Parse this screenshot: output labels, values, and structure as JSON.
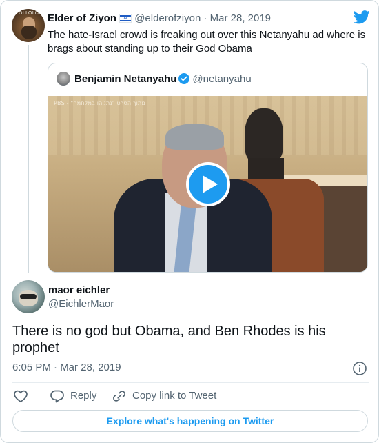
{
  "parent": {
    "avatar_caption": "LOLLOLOL",
    "name": "Elder of Ziyon",
    "handle": "@elderofziyon",
    "separator": "·",
    "date": "Mar 28, 2019",
    "text": "The hate-Israel crowd is freaking out over this Netanyahu ad where is brags about standing up to their God Obama"
  },
  "quoted": {
    "name": "Benjamin Netanyahu",
    "handle": "@netanyahu",
    "video_overlay": "PBS - \"מתוך הסרט \"נתניהו במלחמה"
  },
  "reply": {
    "name": "maor eichler",
    "handle": "@EichlerMaor",
    "text": "There is no god but Obama, and Ben Rhodes is his prophet",
    "timestamp": "6:05 PM · Mar 28, 2019"
  },
  "actions": {
    "reply_label": "Reply",
    "copy_label": "Copy link to Tweet"
  },
  "footer": {
    "explore_label": "Explore what's happening on Twitter"
  },
  "colors": {
    "accent": "#1d9bf0",
    "text": "#0f1419",
    "muted": "#536471",
    "border": "#cfd9de"
  },
  "icons": [
    "twitter-bird-icon",
    "israel-flag-icon",
    "verified-badge-icon",
    "play-icon",
    "info-icon",
    "heart-icon",
    "reply-bubble-icon",
    "link-icon"
  ]
}
